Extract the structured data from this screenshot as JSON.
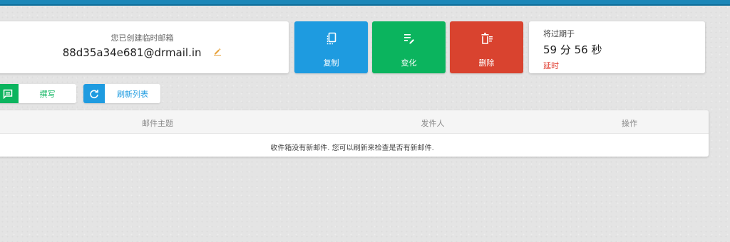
{
  "colors": {
    "top_bar": "#1c87b8",
    "copy_blue": "#1e9be0",
    "change_green": "#0bb45e",
    "delete_red": "#d9432f",
    "extend_red": "#e03b2e",
    "edit_icon_orange": "#e8a33d"
  },
  "email_card": {
    "caption": "您已创建临时邮箱",
    "address": "88d35a34e681@drmail.in",
    "edit_icon": "pencil-icon"
  },
  "actions": {
    "copy_label": "复制",
    "copy_icon": "copy-icon",
    "change_label": "变化",
    "change_icon": "edit-list-icon",
    "delete_label": "删除",
    "delete_icon": "trash-icon"
  },
  "timer": {
    "caption": "将过期于",
    "value": "59 分 56 秒",
    "extend_label": "延时"
  },
  "toolbar": {
    "compose_label": "撰写",
    "compose_icon": "message-icon",
    "refresh_label": "刷新列表",
    "refresh_icon": "refresh-icon"
  },
  "inbox": {
    "columns": [
      "邮件主题",
      "发件人",
      "操作"
    ],
    "empty_message": "收件箱没有新邮件. 您可以刷新来检查是否有新邮件."
  }
}
